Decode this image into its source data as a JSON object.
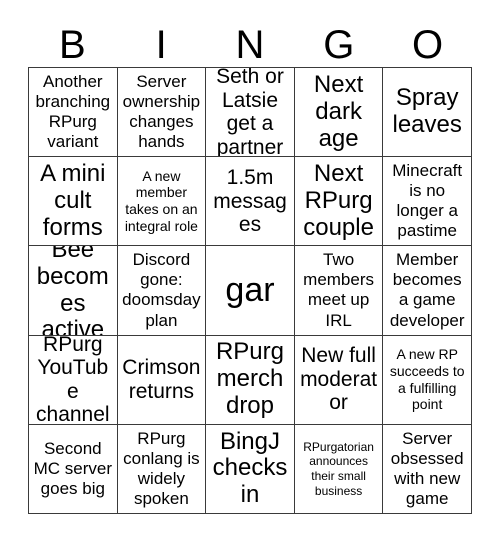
{
  "card": {
    "title": "BINGO",
    "header_letters": [
      "B",
      "I",
      "N",
      "G",
      "O"
    ],
    "rows": 5,
    "columns": 5,
    "border_color": "#3a3a3a",
    "text_color": "#000000",
    "background_color": "#ffffff"
  },
  "cells": [
    {
      "text": "Another branching RPurg variant",
      "size": "md"
    },
    {
      "text": "Server ownership changes hands",
      "size": "md"
    },
    {
      "text": "Seth or Latsie get a partner",
      "size": "lg"
    },
    {
      "text": "Next dark age",
      "size": "xl"
    },
    {
      "text": "Spray leaves",
      "size": "xl"
    },
    {
      "text": "A mini cult forms",
      "size": "xl"
    },
    {
      "text": "A new member takes on an integral role",
      "size": "sm"
    },
    {
      "text": "1.5m messages",
      "size": "lg"
    },
    {
      "text": "Next RPurg couple",
      "size": "xl"
    },
    {
      "text": "Minecraft is no longer a pastime",
      "size": "md"
    },
    {
      "text": "Bee becomes active",
      "size": "xl"
    },
    {
      "text": "Discord gone: doomsday plan",
      "size": "md"
    },
    {
      "text": "gar",
      "size": "xxl"
    },
    {
      "text": "Two members meet up IRL",
      "size": "md"
    },
    {
      "text": "Member becomes a game developer",
      "size": "md"
    },
    {
      "text": "RPurg YouTube channel",
      "size": "lg"
    },
    {
      "text": "Crimson returns",
      "size": "lg"
    },
    {
      "text": "RPurg merch drop",
      "size": "xl"
    },
    {
      "text": "New full moderator",
      "size": "lg"
    },
    {
      "text": "A new RP succeeds to a fulfilling point",
      "size": "sm"
    },
    {
      "text": "Second MC server goes big",
      "size": "md"
    },
    {
      "text": "RPurg conlang is widely spoken",
      "size": "md"
    },
    {
      "text": "BingJ checks in",
      "size": "xl"
    },
    {
      "text": "RPurgatorian announces their small business",
      "size": "xs"
    },
    {
      "text": "Server obsessed with new game",
      "size": "md"
    }
  ]
}
